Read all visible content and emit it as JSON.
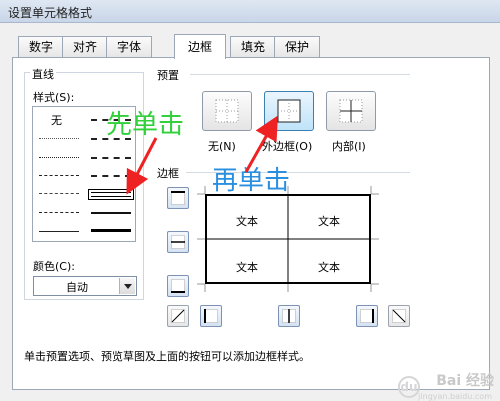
{
  "window": {
    "title": "设置单元格格式",
    "ghost_title": ""
  },
  "tabs": [
    {
      "label": "数字"
    },
    {
      "label": "对齐"
    },
    {
      "label": "字体"
    },
    {
      "label": "边框"
    },
    {
      "label": "填充"
    },
    {
      "label": "保护"
    }
  ],
  "active_tab": "边框",
  "line_group": {
    "title": "直线",
    "style_label": "样式(S):",
    "none_label": "无",
    "color_label": "颜色(C):",
    "color_value": "自动"
  },
  "presets": {
    "title": "预置",
    "items": [
      {
        "label": "无(N)",
        "icon": "border-none-icon"
      },
      {
        "label": "外边框(O)",
        "icon": "border-outline-icon"
      },
      {
        "label": "内部(I)",
        "icon": "border-inside-icon"
      }
    ]
  },
  "border_section": {
    "title": "边框"
  },
  "preview_cells": [
    "文本",
    "文本",
    "文本",
    "文本"
  ],
  "hint": "单击预置选项、预览草图及上面的按钮可以添加边框样式。",
  "annotations": {
    "first": "先单击",
    "second": "再单击"
  },
  "watermark": {
    "text": "Bai 经验",
    "sub": "jingyan.baidu.com",
    "logo": "du"
  },
  "colors": {
    "annot_green": "#32d03a",
    "annot_blue": "#2b8fe0",
    "accent": "#3c7fb1"
  }
}
